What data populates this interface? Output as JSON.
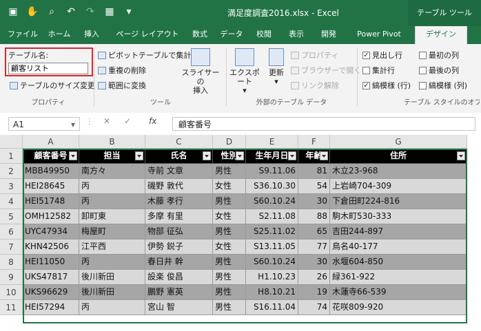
{
  "title_bar": {
    "document_title": "満足度調査2016.xlsx - Excel",
    "contextual_tools": "テーブル ツール"
  },
  "tabs": [
    "ファイル",
    "ホーム",
    "挿入",
    "ページ レイアウト",
    "数式",
    "データ",
    "校閲",
    "表示",
    "開発",
    "Power Pivot",
    "デザイン"
  ],
  "ribbon": {
    "properties": {
      "table_name_label": "テーブル名:",
      "table_name_value": "顧客リスト",
      "resize": "テーブルのサイズ変更",
      "group": "プロパティ"
    },
    "tools": {
      "pivot": "ピボットテーブルで集計",
      "dedupe": "重複の削除",
      "convert": "範囲に変換",
      "slicer_line1": "スライサーの",
      "slicer_line2": "挿入",
      "group": "ツール"
    },
    "external": {
      "export": "エクスポート",
      "refresh": "更新",
      "properties": "プロパティ",
      "open_browser": "ブラウザーで開く",
      "unlink": "リンク解除",
      "group": "外部のテーブル データ"
    },
    "style_options": {
      "header_row": "見出し行",
      "total_row": "集計行",
      "banded_rows": "縞模様 (行)",
      "first_column": "最初の列",
      "last_column": "最後の列",
      "banded_columns": "縞模様 (列)",
      "header_row_checked": true,
      "total_row_checked": false,
      "banded_rows_checked": true,
      "first_column_checked": false,
      "last_column_checked": false,
      "banded_columns_checked": false,
      "group": "テーブル スタイルのオプ"
    }
  },
  "formula_bar": {
    "cell_ref": "A1",
    "fx": "fx",
    "content": "顧客番号"
  },
  "columns": [
    "A",
    "B",
    "C",
    "D",
    "E",
    "F",
    "G"
  ],
  "rows": [
    "1",
    "2",
    "3",
    "4",
    "5",
    "6",
    "7",
    "8",
    "9",
    "10",
    "11"
  ],
  "table": {
    "headers": [
      "顧客番号",
      "担当",
      "氏名",
      "性別",
      "生年月日",
      "年齢",
      "住所"
    ],
    "data": [
      [
        "MBB49950",
        "南方々",
        "寺前 文章",
        "男性",
        "S9.11.06",
        "81",
        "木立23-968"
      ],
      [
        "HEI28645",
        "丙",
        "磯野 敦代",
        "女性",
        "S36.10.30",
        "54",
        "上岩崎704-309"
      ],
      [
        "HEI51748",
        "丙",
        "木藤 孝行",
        "男性",
        "S60.10.24",
        "30",
        "下倉田町224-816"
      ],
      [
        "OMH12582",
        "卸町東",
        "多摩 有里",
        "女性",
        "S2.11.08",
        "88",
        "駒木町530-333"
      ],
      [
        "UYC47934",
        "梅屋町",
        "物部 征弘",
        "男性",
        "S25.11.02",
        "65",
        "吉田244-897"
      ],
      [
        "KHN42506",
        "江平西",
        "伊勢 鋭子",
        "女性",
        "S13.11.05",
        "77",
        "鳥名40-177"
      ],
      [
        "HEI11050",
        "丙",
        "春日井 幹",
        "男性",
        "S60.10.24",
        "30",
        "水堰604-850"
      ],
      [
        "UKS47817",
        "後川新田",
        "設楽 俊昌",
        "男性",
        "H1.10.23",
        "26",
        "緑361-922"
      ],
      [
        "UKS96629",
        "後川新田",
        "鵬野 憲英",
        "男性",
        "H8.10.21",
        "19",
        "木蓮寺66-539"
      ],
      [
        "HEI57294",
        "丙",
        "宮山 智",
        "男性",
        "S16.11.04",
        "74",
        "花咲809-920"
      ]
    ]
  }
}
